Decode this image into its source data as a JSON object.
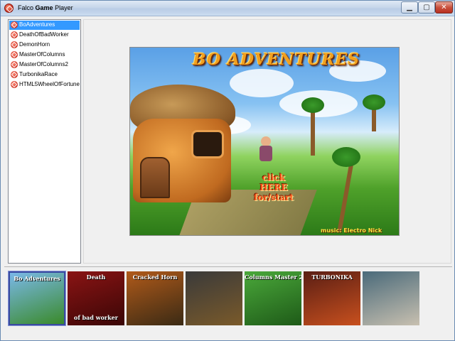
{
  "window": {
    "title_prefix": "Falco",
    "title_bold": "Game",
    "title_suffix": "Player",
    "min_symbol": "▁",
    "max_symbol": "▢",
    "close_symbol": "✕"
  },
  "game_list": {
    "items": [
      {
        "label": "BoAdventures",
        "selected": true
      },
      {
        "label": "DeathOfBadWorker",
        "selected": false
      },
      {
        "label": "DemonHorn",
        "selected": false
      },
      {
        "label": "MasterOfColumns",
        "selected": false
      },
      {
        "label": "MasterOfColumns2",
        "selected": false
      },
      {
        "label": "TurbonikaRace",
        "selected": false
      },
      {
        "label": "HTML5WheelOfFortune",
        "selected": false
      }
    ]
  },
  "preview": {
    "title": "BO ADVENTURES",
    "click_line1": "click",
    "click_line2": "HERE",
    "click_line3": "for/start",
    "credit": "music: Electro Nick"
  },
  "thumbnails": [
    {
      "label": "Bo Adventures",
      "colors": [
        "#7ab8e8",
        "#3a8a2a"
      ]
    },
    {
      "label": "Death",
      "label2": "of bad worker",
      "colors": [
        "#8a1414",
        "#3a0606"
      ]
    },
    {
      "label": "Cracked Horn",
      "colors": [
        "#b05a1a",
        "#3a2a14"
      ]
    },
    {
      "label": "",
      "colors": [
        "#3a3a3a",
        "#7a5a2a"
      ]
    },
    {
      "label": "Columns Master 2",
      "colors": [
        "#4aa83a",
        "#1e5a18"
      ]
    },
    {
      "label": "TURBONIKA",
      "colors": [
        "#5a1e14",
        "#c8501e"
      ]
    },
    {
      "label": "",
      "colors": [
        "#4a6a7a",
        "#c8c0b0"
      ]
    }
  ]
}
